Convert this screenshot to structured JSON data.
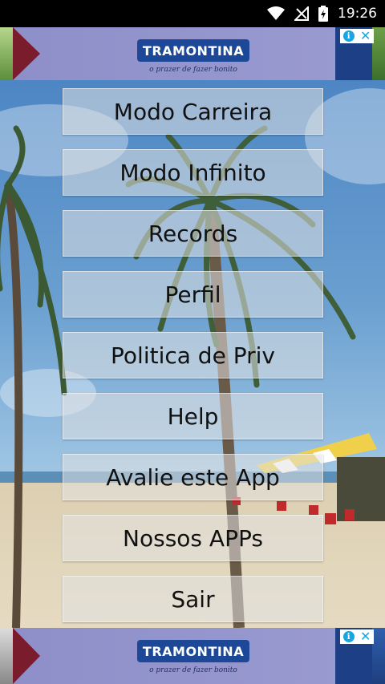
{
  "status_bar": {
    "time": "19:26",
    "icons": [
      "wifi-icon",
      "signal-off-icon",
      "battery-charging-icon"
    ]
  },
  "ads": {
    "brand": "TRAMONTINA",
    "tagline": "o prazer de fazer bonito",
    "info_glyph": "i",
    "close_glyph": "✕"
  },
  "menu": {
    "items": [
      {
        "label": "Modo Carreira"
      },
      {
        "label": "Modo Infinito"
      },
      {
        "label": "Records"
      },
      {
        "label": "Perfil"
      },
      {
        "label": "Politica de Priv"
      },
      {
        "label": "Help"
      },
      {
        "label": "Avalie este App"
      },
      {
        "label": "Nossos APPs"
      },
      {
        "label": "Sair"
      }
    ]
  },
  "colors": {
    "status_bg": "#000000",
    "brand_blue": "#1d4797",
    "ad_bg": "#9a9bd0"
  }
}
